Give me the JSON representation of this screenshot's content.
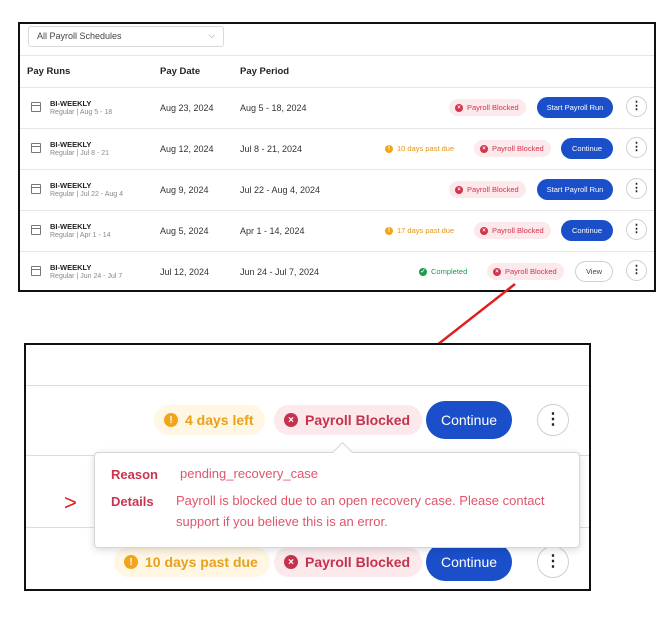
{
  "filter": {
    "selected": "All Payroll Schedules"
  },
  "table": {
    "headers": {
      "pay_runs": "Pay Runs",
      "pay_date": "Pay Date",
      "pay_period": "Pay Period"
    },
    "rows": [
      {
        "name": "BI-WEEKLY",
        "sub": "Regular | Aug 5 - 18",
        "pay_date": "Aug 23, 2024",
        "pay_period": "Aug 5 - 18, 2024",
        "status1": "",
        "status2": "Payroll Blocked",
        "action": "Start Payroll Run"
      },
      {
        "name": "BI-WEEKLY",
        "sub": "Regular | Jul 8 - 21",
        "pay_date": "Aug 12, 2024",
        "pay_period": "Jul 8 - 21, 2024",
        "status1": "10 days past due",
        "status2": "Payroll Blocked",
        "action": "Continue"
      },
      {
        "name": "BI-WEEKLY",
        "sub": "Regular | Jul 22 - Aug 4",
        "pay_date": "Aug 9, 2024",
        "pay_period": "Jul 22 - Aug 4, 2024",
        "status1": "",
        "status2": "Payroll Blocked",
        "action": "Start Payroll Run"
      },
      {
        "name": "BI-WEEKLY",
        "sub": "Regular | Apr 1 - 14",
        "pay_date": "Aug 5, 2024",
        "pay_period": "Apr 1 - 14, 2024",
        "status1": "17 days past due",
        "status2": "Payroll Blocked",
        "action": "Continue"
      },
      {
        "name": "BI-WEEKLY",
        "sub": "Regular | Jun 24 - Jul 7",
        "pay_date": "Jul 12, 2024",
        "pay_period": "Jun 24 - Jul 7, 2024",
        "status1": "Completed",
        "status2": "Payroll Blocked",
        "action": "View"
      }
    ]
  },
  "zoom": {
    "row1": {
      "status1": "4 days left",
      "status2": "Payroll Blocked",
      "action": "Continue"
    },
    "tooltip": {
      "reason_label": "Reason",
      "reason_value": "pending_recovery_case",
      "details_label": "Details",
      "details_line1": "Payroll is blocked due to an open recovery case. Please contact",
      "details_line2": "support if you believe this is an error."
    },
    "row2": {
      "status1": "10 days past due",
      "status2": "Payroll Blocked",
      "action": "Continue"
    },
    "marker": ">"
  },
  "colors": {
    "blocked": "#d6324a",
    "due": "#f2a516",
    "completed": "#1e9a4d",
    "primary": "#1a4fc9",
    "arrow": "#e02020"
  }
}
